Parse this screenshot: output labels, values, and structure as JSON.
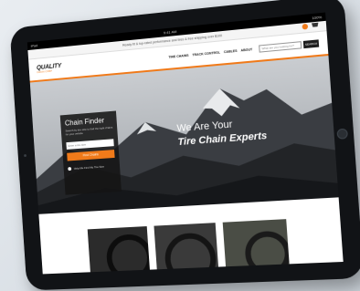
{
  "status_bar": {
    "left": "iPad",
    "center": "9:41 AM",
    "right": "100%"
  },
  "promo": {
    "text": "Ready-fit & top-rated performance and tires & free shipping over $100"
  },
  "logo": {
    "name": "QUALITY",
    "sub": "CHAIN CORP"
  },
  "nav": {
    "items": [
      "TIRE CHAINS",
      "TRACK CONTROL",
      "CABLES",
      "ABOUT"
    ],
    "search_placeholder": "What are you looking for?",
    "search_button": "SEARCH"
  },
  "finder": {
    "title": "Chain Finder",
    "description": "Search by tire size to find the right chains for your vehicle",
    "input_placeholder": "Enter a tire size",
    "button": "Find Chains",
    "checkbox_label": "Help Me Find My Tire Size"
  },
  "hero": {
    "tagline_1": "We Are Your",
    "tagline_2": "Tire Chain Experts"
  },
  "colors": {
    "accent": "#f07a1a",
    "bezel": "#111316"
  },
  "icons": [
    "user-icon",
    "cart-icon",
    "home-button-icon"
  ]
}
